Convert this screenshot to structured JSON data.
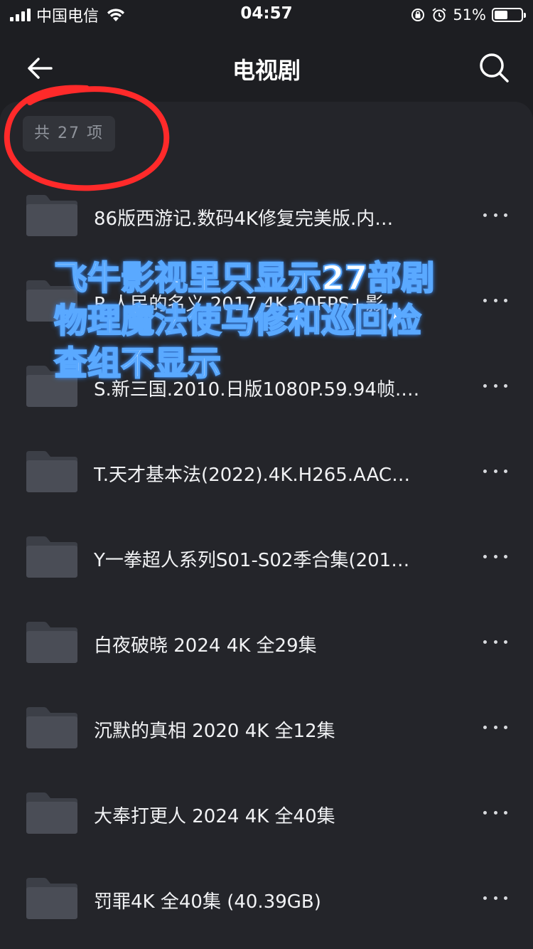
{
  "status_bar": {
    "carrier": "中国电信",
    "time": "04:57",
    "battery_percent": "51%",
    "battery_level": 0.51,
    "icons": [
      "signal-icon",
      "wifi-icon",
      "rotation-lock-icon",
      "alarm-icon",
      "battery-icon"
    ]
  },
  "nav": {
    "title": "电视剧",
    "back_icon": "arrow-left-icon",
    "search_icon": "search-icon"
  },
  "count_label": "共 27 项",
  "items": [
    {
      "name": "86版西游记.数码4K修复完美版.内…"
    },
    {
      "name": "R.人民的名义.2017.4K.60FPS+影…"
    },
    {
      "name": "S.新三国.2010.日版1080P.59.94帧.…"
    },
    {
      "name": "T.天才基本法(2022).4K.H265.AAC…"
    },
    {
      "name": "Y一拳超人系列S01-S02季合集(201…"
    },
    {
      "name": "白夜破晓 2024 4K 全29集"
    },
    {
      "name": "沉默的真相 2020 4K 全12集"
    },
    {
      "name": "大奉打更人 2024 4K 全40集"
    },
    {
      "name": "罚罪4K 全40集 (40.39GB)"
    }
  ],
  "annotation": {
    "caption_lines": [
      "飞牛影视里只显示27部剧",
      "物理魔法使马修和巡回检",
      "查组不显示"
    ],
    "caption_color": "#5aa9ff",
    "circle_color": "#ff2a2a"
  },
  "colors": {
    "background": "#1d1e22",
    "panel": "#24252a",
    "folder": "#4a4d56"
  }
}
